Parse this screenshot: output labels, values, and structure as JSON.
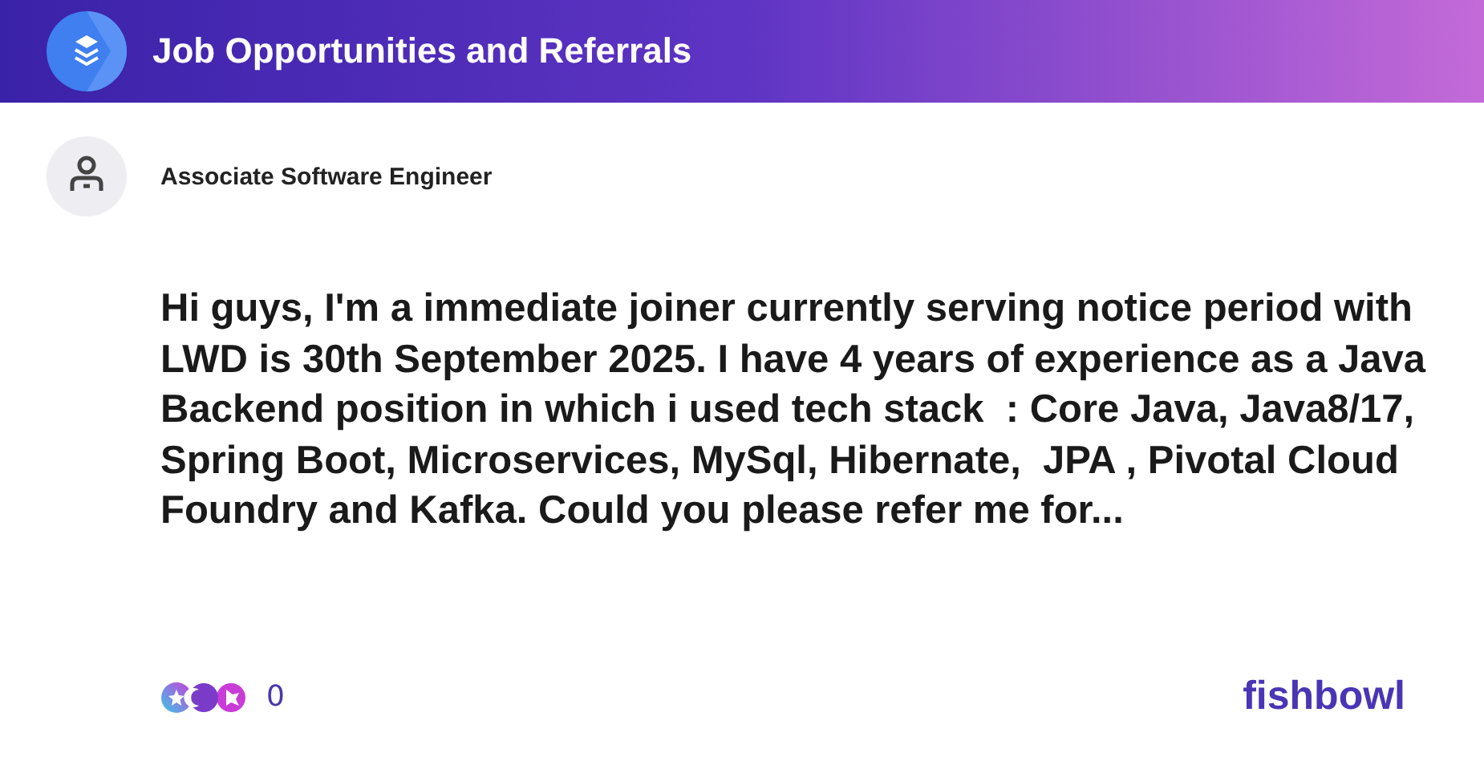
{
  "header": {
    "title": "Job Opportunities and Referrals"
  },
  "post": {
    "author": "Associate Software Engineer",
    "body": "Hi guys, I'm a immediate joiner currently serving notice period with LWD is 30th September 2025. I have 4 years of experience as a Java Backend position in which i used tech stack  : Core Java, Java8/17, Spring Boot, Microservices, MySql, Hibernate,  JPA , Pivotal Cloud Foundry and Kafka. Could you please refer me for...",
    "reaction_count": "0"
  },
  "logo": "fishbowl"
}
